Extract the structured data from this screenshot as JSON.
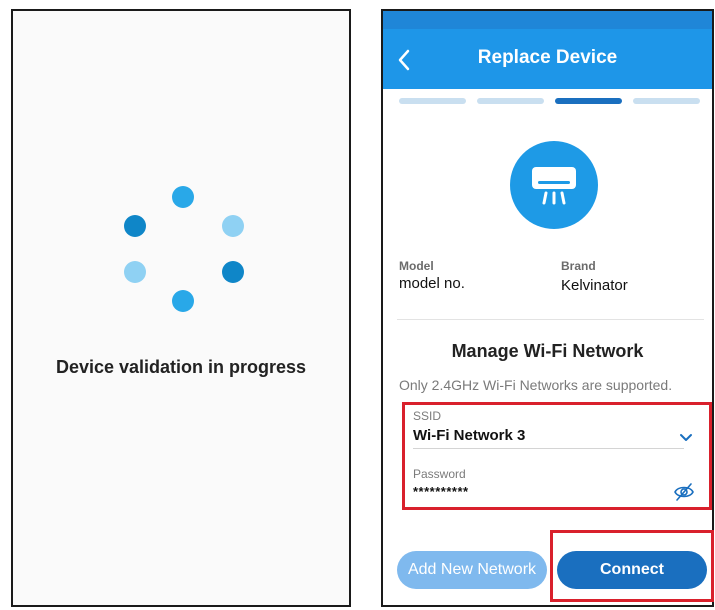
{
  "left_screen": {
    "status_text": "Device validation in progress",
    "spinner_colors": [
      "#29a8e8",
      "#8fd1f3",
      "#0f86c8",
      "#29a8e8",
      "#8fd1f3",
      "#0f86c8"
    ]
  },
  "right_screen": {
    "header": {
      "back_icon": "chevron-left-icon",
      "title": "Replace Device"
    },
    "steps": {
      "total": 4,
      "active": 3
    },
    "device_icon": "air-conditioner-icon",
    "model": {
      "label": "Model",
      "value": "model no."
    },
    "brand": {
      "label": "Brand",
      "value": "Kelvinator"
    },
    "wifi": {
      "title": "Manage Wi-Fi Network",
      "note": "Only 2.4GHz Wi-Fi Networks are supported.",
      "ssid_label": "SSID",
      "ssid_value": "Wi-Fi Network 3",
      "password_label": "Password",
      "password_value": "**********",
      "dropdown_icon": "chevron-down-icon",
      "visibility_icon": "eye-off-icon"
    },
    "buttons": {
      "add_network": "Add New Network",
      "connect": "Connect"
    }
  },
  "colors": {
    "header_blue": "#1e96e8",
    "accent_dark": "#1a6fbf",
    "accent_light": "#7fb9ee",
    "highlight_red": "#d9202c"
  }
}
